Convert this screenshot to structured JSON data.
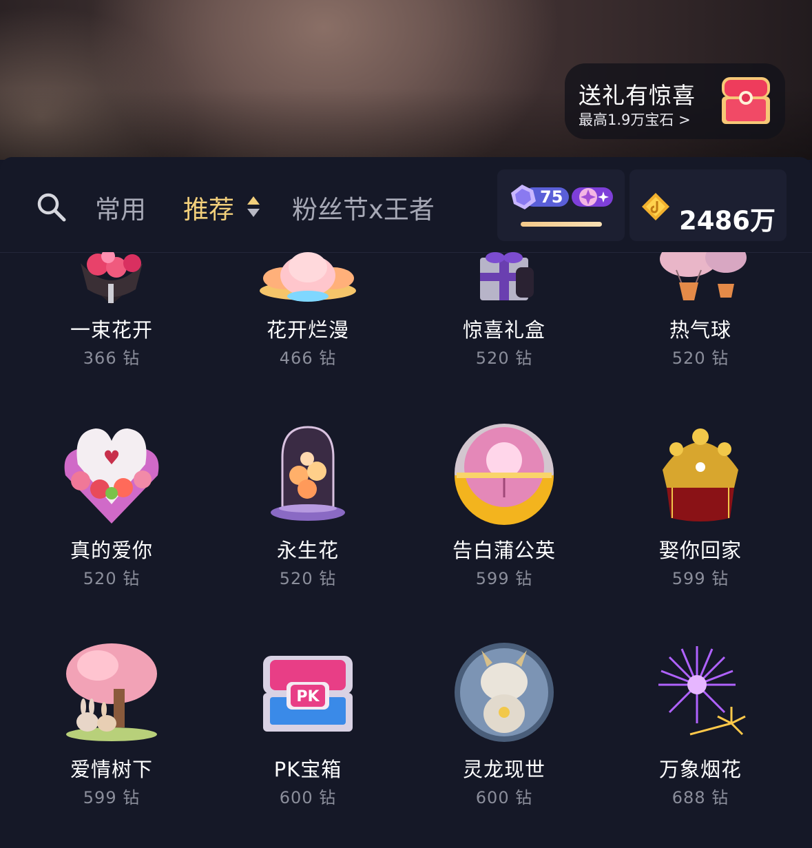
{
  "promo": {
    "title": "送礼有惊喜",
    "subtitle": "最高1.9万宝石 >",
    "icon": "gift-chest-icon"
  },
  "tabs": {
    "search_icon": "search-icon",
    "items": [
      {
        "label": "常用"
      },
      {
        "label": "推荐",
        "active": true
      },
      {
        "label": "粉丝节x王者"
      }
    ],
    "active_color": "#f2cf7b"
  },
  "level": {
    "value": "75"
  },
  "balance": {
    "icon": "diamond-coin-icon",
    "amount": "2486万"
  },
  "gifts": [
    {
      "name": "一束花开",
      "price": "366 钻",
      "icon": "flower-bouquet-icon"
    },
    {
      "name": "花开烂漫",
      "price": "466 钻",
      "icon": "lotus-icon"
    },
    {
      "name": "惊喜礼盒",
      "price": "520 钻",
      "icon": "gift-box-icon"
    },
    {
      "name": "热气球",
      "price": "520 钻",
      "icon": "hot-air-balloon-icon"
    },
    {
      "name": "真的爱你",
      "price": "520 钻",
      "icon": "heart-roses-icon"
    },
    {
      "name": "永生花",
      "price": "520 钻",
      "icon": "glass-dome-flower-icon"
    },
    {
      "name": "告白蒲公英",
      "price": "599 钻",
      "icon": "dandelion-capsule-icon"
    },
    {
      "name": "娶你回家",
      "price": "599 钻",
      "icon": "phoenix-crown-icon"
    },
    {
      "name": "爱情树下",
      "price": "599 钻",
      "icon": "love-tree-bunnies-icon"
    },
    {
      "name": "PK宝箱",
      "price": "600 钻",
      "icon": "pk-chest-icon"
    },
    {
      "name": "灵龙现世",
      "price": "600 钻",
      "icon": "dragon-bubble-icon"
    },
    {
      "name": "万象烟花",
      "price": "688 钻",
      "icon": "fireworks-icon"
    }
  ]
}
